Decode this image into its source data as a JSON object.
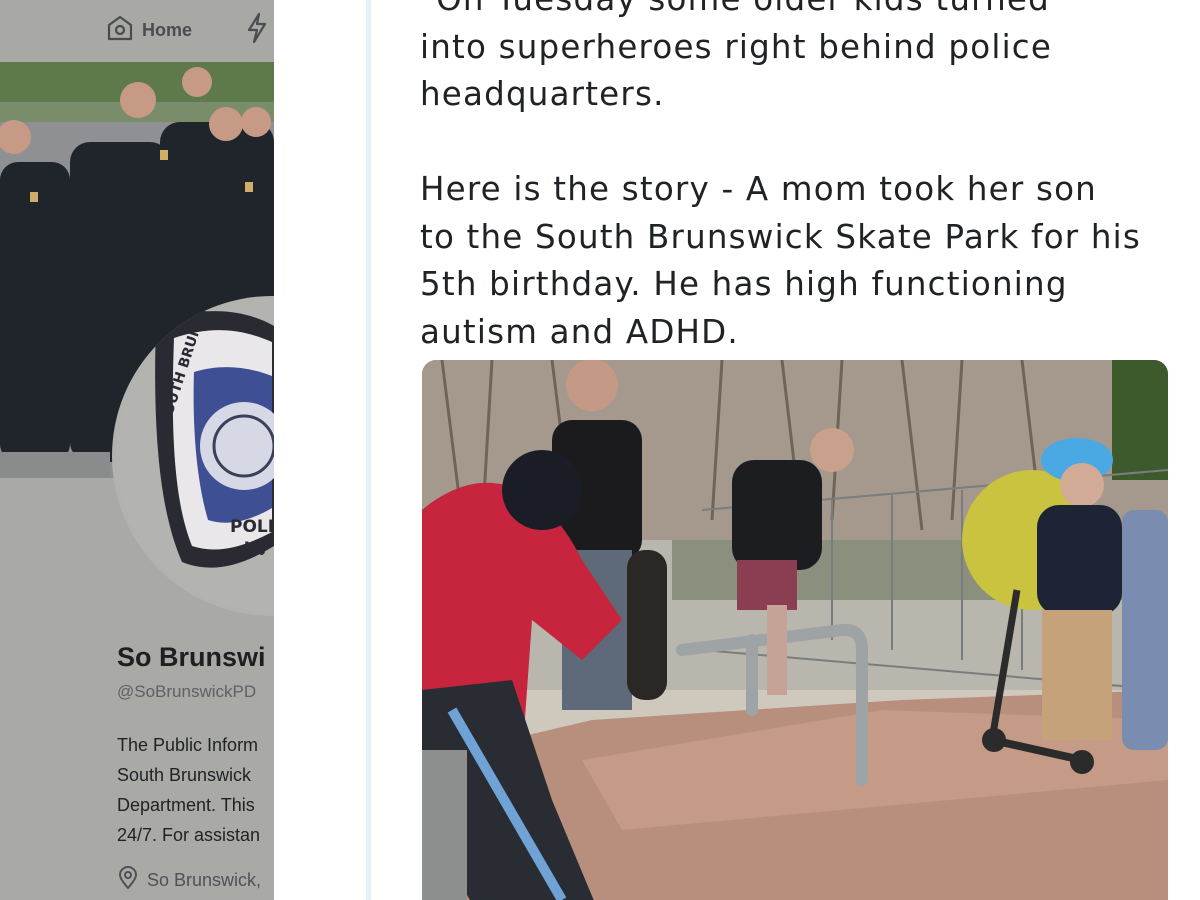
{
  "nav": {
    "home_label": "Home",
    "home_icon": "home-icon",
    "moments_icon": "lightning-icon"
  },
  "profile": {
    "name": "So Brunswi",
    "handle": "@SoBrunswickPD",
    "bio_lines": [
      "The Public Inform",
      "South Brunswick",
      "Department. This",
      "24/7. For assistan"
    ],
    "location": "So Brunswick,",
    "location_icon": "location-pin-icon",
    "badge_text_top": "SOUTH BRUNSW",
    "badge_text_bottom": "POLI",
    "badge_text_state": "N.J"
  },
  "tweet": {
    "text_lines": [
      "\"On Tuesday some older kids turned",
      "into superheroes right behind police",
      "headquarters."
    ],
    "text_lines_2": [
      "Here is the story - A mom took her son",
      "to the South Brunswick Skate Park for his",
      "5th birthday. He has high functioning",
      "autism and ADHD."
    ]
  },
  "colors": {
    "dim_panel": "#a9aaa6",
    "tweet_text": "#202326",
    "gutter_line": "#e7f1f7"
  }
}
